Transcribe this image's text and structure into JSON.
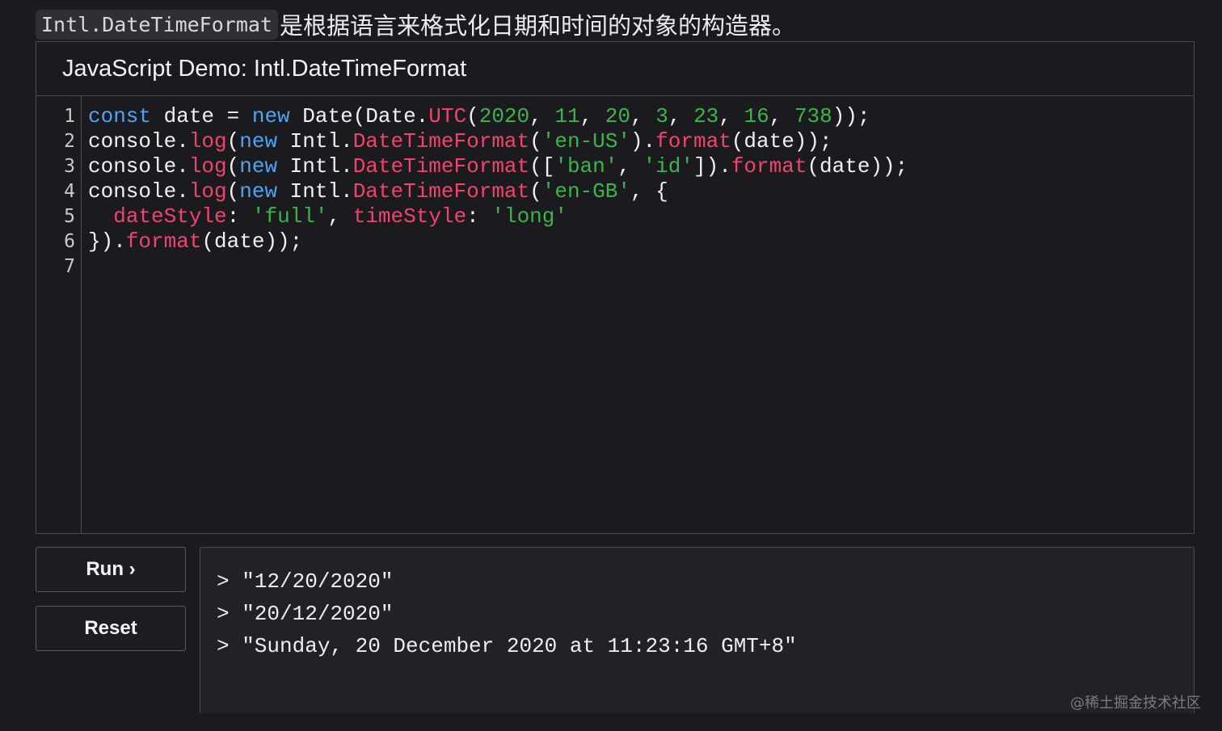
{
  "intro": {
    "code": "Intl.DateTimeFormat",
    "text": "是根据语言来格式化日期和时间的对象的构造器。"
  },
  "demo": {
    "title": "JavaScript Demo: Intl.DateTimeFormat",
    "line_numbers": [
      "1",
      "2",
      "3",
      "4",
      "5",
      "6",
      "7"
    ],
    "code_lines": [
      [
        {
          "t": "kw",
          "s": "const"
        },
        {
          "t": "plain",
          "s": " date = "
        },
        {
          "t": "kw",
          "s": "new"
        },
        {
          "t": "plain",
          "s": " Date(Date."
        },
        {
          "t": "fn",
          "s": "UTC"
        },
        {
          "t": "plain",
          "s": "("
        },
        {
          "t": "num",
          "s": "2020"
        },
        {
          "t": "plain",
          "s": ", "
        },
        {
          "t": "num",
          "s": "11"
        },
        {
          "t": "plain",
          "s": ", "
        },
        {
          "t": "num",
          "s": "20"
        },
        {
          "t": "plain",
          "s": ", "
        },
        {
          "t": "num",
          "s": "3"
        },
        {
          "t": "plain",
          "s": ", "
        },
        {
          "t": "num",
          "s": "23"
        },
        {
          "t": "plain",
          "s": ", "
        },
        {
          "t": "num",
          "s": "16"
        },
        {
          "t": "plain",
          "s": ", "
        },
        {
          "t": "num",
          "s": "738"
        },
        {
          "t": "plain",
          "s": "));"
        }
      ],
      [
        {
          "t": "plain",
          "s": "console."
        },
        {
          "t": "fn",
          "s": "log"
        },
        {
          "t": "plain",
          "s": "("
        },
        {
          "t": "kw",
          "s": "new"
        },
        {
          "t": "plain",
          "s": " Intl."
        },
        {
          "t": "fn",
          "s": "DateTimeFormat"
        },
        {
          "t": "plain",
          "s": "("
        },
        {
          "t": "str",
          "s": "'en-US'"
        },
        {
          "t": "plain",
          "s": ")."
        },
        {
          "t": "fn",
          "s": "format"
        },
        {
          "t": "plain",
          "s": "(date));"
        }
      ],
      [
        {
          "t": "plain",
          "s": "console."
        },
        {
          "t": "fn",
          "s": "log"
        },
        {
          "t": "plain",
          "s": "("
        },
        {
          "t": "kw",
          "s": "new"
        },
        {
          "t": "plain",
          "s": " Intl."
        },
        {
          "t": "fn",
          "s": "DateTimeFormat"
        },
        {
          "t": "plain",
          "s": "(["
        },
        {
          "t": "str",
          "s": "'ban'"
        },
        {
          "t": "plain",
          "s": ", "
        },
        {
          "t": "str",
          "s": "'id'"
        },
        {
          "t": "plain",
          "s": "])."
        },
        {
          "t": "fn",
          "s": "format"
        },
        {
          "t": "plain",
          "s": "(date));"
        }
      ],
      [
        {
          "t": "plain",
          "s": "console."
        },
        {
          "t": "fn",
          "s": "log"
        },
        {
          "t": "plain",
          "s": "("
        },
        {
          "t": "kw",
          "s": "new"
        },
        {
          "t": "plain",
          "s": " Intl."
        },
        {
          "t": "fn",
          "s": "DateTimeFormat"
        },
        {
          "t": "plain",
          "s": "("
        },
        {
          "t": "str",
          "s": "'en-GB'"
        },
        {
          "t": "plain",
          "s": ", {"
        }
      ],
      [
        {
          "t": "plain",
          "s": "  "
        },
        {
          "t": "prop",
          "s": "dateStyle"
        },
        {
          "t": "plain",
          "s": ": "
        },
        {
          "t": "str",
          "s": "'full'"
        },
        {
          "t": "plain",
          "s": ", "
        },
        {
          "t": "prop",
          "s": "timeStyle"
        },
        {
          "t": "plain",
          "s": ": "
        },
        {
          "t": "str",
          "s": "'long'"
        }
      ],
      [
        {
          "t": "plain",
          "s": "})."
        },
        {
          "t": "fn",
          "s": "format"
        },
        {
          "t": "plain",
          "s": "(date));"
        }
      ],
      []
    ]
  },
  "buttons": {
    "run": "Run ›",
    "reset": "Reset"
  },
  "console": {
    "outputs": [
      "> \"12/20/2020\"",
      "> \"20/12/2020\"",
      "> \"Sunday, 20 December 2020 at 11:23:16 GMT+8\""
    ]
  },
  "watermark": "@稀土掘金技术社区",
  "colors": {
    "background": "#1b1b1f",
    "keyword": "#4fa3f2",
    "function": "#f0446d",
    "string_number": "#3bb54a"
  }
}
